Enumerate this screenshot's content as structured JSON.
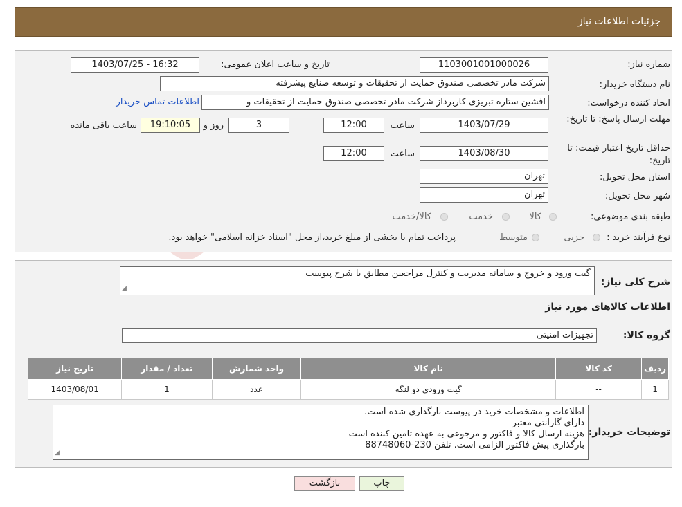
{
  "header": {
    "title": "جزئیات اطلاعات نیاز"
  },
  "watermark": {
    "text": "AriaTender.neT"
  },
  "form": {
    "need_number_label": "شماره نیاز:",
    "need_number": "1103001001000026",
    "announce_label": "تاریخ و ساعت اعلان عمومی:",
    "announce_value": "1403/07/25 - 16:32",
    "buyer_label": "نام دستگاه خریدار:",
    "buyer_value": "شرکت مادر تخصصی صندوق حمایت از تحقیقات و توسعه صنایع پیشرفته",
    "creator_label": "ایجاد کننده درخواست:",
    "creator_value": "افشین  ستاره تبریزی کاربرداز شرکت مادر تخصصی صندوق حمایت از تحقیقات و",
    "contact_link": "اطلاعات تماس خریدار",
    "deadline_label": "مهلت ارسال پاسخ: تا تاریخ:",
    "deadline_date": "1403/07/29",
    "time_label": "ساعت",
    "deadline_time": "12:00",
    "days_value": "3",
    "days_label": "روز و",
    "remaining_value": "19:10:05",
    "remaining_label": "ساعت باقی مانده",
    "validity_label": "حداقل تاریخ اعتبار قیمت: تا تاریخ:",
    "validity_date": "1403/08/30",
    "validity_time": "12:00",
    "province_label": "استان محل تحویل:",
    "province_value": "تهران",
    "city_label": "شهر محل تحویل:",
    "city_value": "تهران",
    "category_label": "طبقه بندی موضوعی:",
    "category_options": [
      "کالا",
      "خدمت",
      "کالا/خدمت"
    ],
    "process_label": "نوع فرآیند خرید :",
    "process_options": [
      "جزیی",
      "متوسط"
    ],
    "process_note": "پرداخت تمام یا بخشی از مبلغ خرید،از محل \"اسناد خزانه اسلامی\" خواهد بود."
  },
  "description": {
    "label": "شرح کلی نیاز:",
    "value": "گیت ورود و خروج و سامانه مدیریت و کنترل مراجعین مطابق با شرح پیوست"
  },
  "goods": {
    "section_title": "اطلاعات کالاهای مورد نیاز",
    "group_label": "گروه کالا:",
    "group_value": "تجهیزات امنیتی",
    "columns": [
      "ردیف",
      "کد کالا",
      "نام کالا",
      "واحد شمارش",
      "تعداد / مقدار",
      "تاریخ نیاز"
    ],
    "rows": [
      {
        "row": "1",
        "code": "--",
        "name": "گیت ورودی دو لنگه",
        "unit": "عدد",
        "qty": "1",
        "date": "1403/08/01"
      }
    ]
  },
  "buyer_notes": {
    "label": "توضیحات خریدار:",
    "lines": [
      "اطلاعات و مشخصات خرید در پیوست بارگذاری شده است.",
      "دارای گارانتی معتبر",
      "هزینه ارسال کالا و فاکتور و مرجوعی به عهده تامین کننده است",
      "بارگذاری پیش فاکتور الزامی است. تلفن 230-88748060"
    ]
  },
  "buttons": {
    "print": "چاپ",
    "back": "بازگشت"
  },
  "colors": {
    "header": "#8b6a3e",
    "print_bg": "#eaf5dc",
    "back_bg": "#f9dede"
  }
}
